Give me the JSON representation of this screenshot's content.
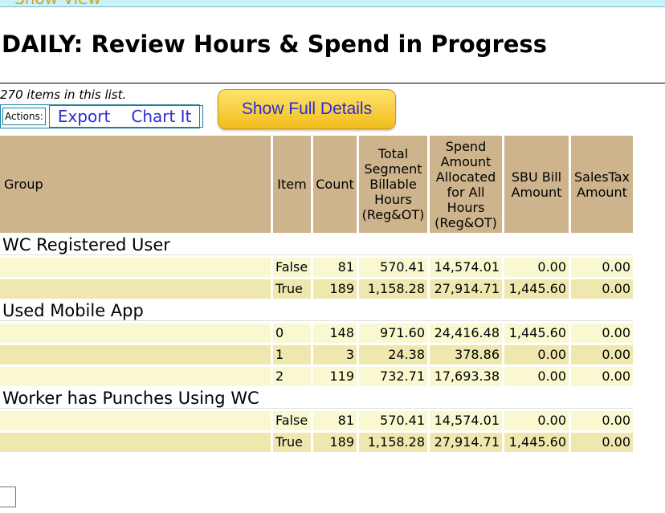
{
  "header": {
    "banner_text": "Show View",
    "title": "DAILY: Review Hours & Spend in Progress",
    "item_count": "270 items in this list."
  },
  "actions": {
    "label": "Actions:",
    "export": "Export",
    "chart": "Chart It"
  },
  "full_details_button": "Show Full Details",
  "table": {
    "columns": {
      "group": "Group",
      "item": "Item",
      "count": "Count",
      "hours": "Total Segment Billable Hours (Reg&OT)",
      "spend": "Spend Amount Allocated for All Hours (Reg&OT)",
      "sbu": "SBU Bill Amount",
      "tax": "SalesTax Amount"
    },
    "groups": [
      {
        "name": "WC Registered User",
        "rows": [
          {
            "item": "False",
            "count": "81",
            "hours": "570.41",
            "spend": "14,574.01",
            "sbu": "0.00",
            "tax": "0.00"
          },
          {
            "item": "True",
            "count": "189",
            "hours": "1,158.28",
            "spend": "27,914.71",
            "sbu": "1,445.60",
            "tax": "0.00"
          }
        ]
      },
      {
        "name": "Used Mobile App",
        "rows": [
          {
            "item": "0",
            "count": "148",
            "hours": "971.60",
            "spend": "24,416.48",
            "sbu": "1,445.60",
            "tax": "0.00"
          },
          {
            "item": "1",
            "count": "3",
            "hours": "24.38",
            "spend": "378.86",
            "sbu": "0.00",
            "tax": "0.00"
          },
          {
            "item": "2",
            "count": "119",
            "hours": "732.71",
            "spend": "17,693.38",
            "sbu": "0.00",
            "tax": "0.00"
          }
        ]
      },
      {
        "name": "Worker has Punches Using WC",
        "rows": [
          {
            "item": "False",
            "count": "81",
            "hours": "570.41",
            "spend": "14,574.01",
            "sbu": "0.00",
            "tax": "0.00"
          },
          {
            "item": "True",
            "count": "189",
            "hours": "1,158.28",
            "spend": "27,914.71",
            "sbu": "1,445.60",
            "tax": "0.00"
          }
        ]
      }
    ]
  },
  "colors": {
    "header_bg": "#cdb48c",
    "row_light": "#faf8d0",
    "row_dark": "#efe8ae",
    "link": "#2b2bd8",
    "button": "#f2bd1d"
  }
}
